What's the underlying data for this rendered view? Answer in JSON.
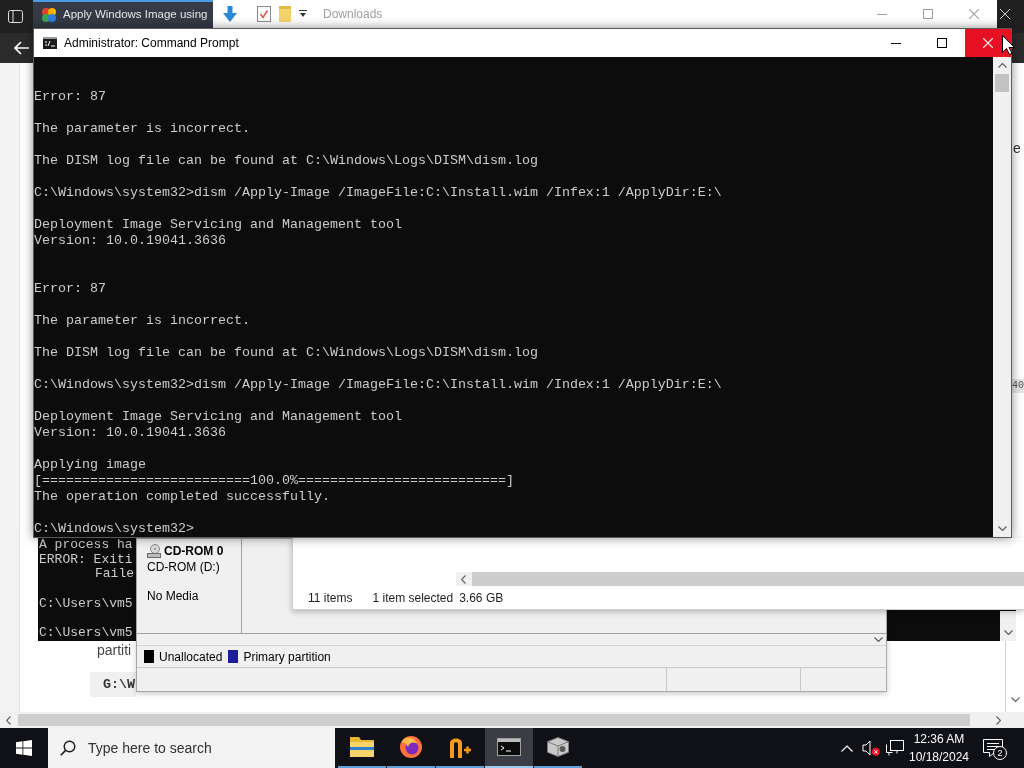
{
  "browser": {
    "tab": {
      "title": "Apply Windows Image using"
    },
    "page": {
      "right_edge_word": "e",
      "right_edge_code": "40",
      "paragraph_word": "partiti",
      "code_block": "G:\\W"
    }
  },
  "explorer": {
    "title": "Downloads",
    "active": false,
    "status_bar": {
      "items": "11 items",
      "selection": "1 item selected",
      "size": "3.66 GB"
    }
  },
  "background_console": {
    "lines": [
      {
        "kind": "text",
        "text": "A process ha"
      },
      {
        "kind": "text",
        "text": "ERROR: Exiti"
      },
      {
        "kind": "indented",
        "text": "Faile"
      },
      {
        "kind": "blank"
      },
      {
        "kind": "text",
        "text": "C:\\Users\\vm5"
      },
      {
        "kind": "blank"
      },
      {
        "kind": "text",
        "text": "C:\\Users\\vm5"
      }
    ]
  },
  "disk_management": {
    "disk": {
      "name": "CD-ROM 0",
      "volume": "CD-ROM (D:)",
      "status": "No Media"
    },
    "legend": [
      {
        "label": "Unallocated",
        "color": "#000000"
      },
      {
        "label": "Primary partition",
        "color": "#1c1c9e"
      }
    ]
  },
  "command_prompt": {
    "title": "Administrator: Command Prompt",
    "active": true,
    "close_button": {
      "hovered": true
    },
    "lines": [
      {
        "kind": "blank"
      },
      {
        "kind": "blank"
      },
      {
        "kind": "text",
        "text": "Error: 87"
      },
      {
        "kind": "blank"
      },
      {
        "kind": "text",
        "text": "The parameter is incorrect."
      },
      {
        "kind": "blank"
      },
      {
        "kind": "text",
        "text": "The DISM log file can be found at C:\\Windows\\Logs\\DISM\\dism.log"
      },
      {
        "kind": "blank"
      },
      {
        "kind": "text",
        "text": "C:\\Windows\\system32>dism /Apply-Image /ImageFile:C:\\Install.wim /Infex:1 /ApplyDir:E:\\"
      },
      {
        "kind": "blank"
      },
      {
        "kind": "text",
        "text": "Deployment Image Servicing and Management tool"
      },
      {
        "kind": "text",
        "text": "Version: 10.0.19041.3636"
      },
      {
        "kind": "blank"
      },
      {
        "kind": "blank"
      },
      {
        "kind": "text",
        "text": "Error: 87"
      },
      {
        "kind": "blank"
      },
      {
        "kind": "text",
        "text": "The parameter is incorrect."
      },
      {
        "kind": "blank"
      },
      {
        "kind": "text",
        "text": "The DISM log file can be found at C:\\Windows\\Logs\\DISM\\dism.log"
      },
      {
        "kind": "blank"
      },
      {
        "kind": "text",
        "text": "C:\\Windows\\system32>dism /Apply-Image /ImageFile:C:\\Install.wim /Index:1 /ApplyDir:E:\\"
      },
      {
        "kind": "blank"
      },
      {
        "kind": "text",
        "text": "Deployment Image Servicing and Management tool"
      },
      {
        "kind": "text",
        "text": "Version: 10.0.19041.3636"
      },
      {
        "kind": "blank"
      },
      {
        "kind": "text",
        "text": "Applying image"
      },
      {
        "kind": "text",
        "text": "[==========================100.0%==========================]"
      },
      {
        "kind": "text",
        "text": "The operation completed successfully."
      },
      {
        "kind": "blank"
      },
      {
        "kind": "text",
        "text": "C:\\Windows\\system32>"
      }
    ]
  },
  "taskbar": {
    "search": {
      "placeholder": "Type here to search"
    },
    "apps": [
      {
        "kind": "explorer",
        "selected": false
      },
      {
        "kind": "browser",
        "selected": false
      },
      {
        "kind": "editor",
        "selected": false
      },
      {
        "kind": "console",
        "selected": true
      },
      {
        "kind": "setup",
        "selected": false
      }
    ],
    "clock": {
      "time": "12:36 AM",
      "date": "10/18/2024"
    },
    "notifications": {
      "count": "2"
    }
  }
}
